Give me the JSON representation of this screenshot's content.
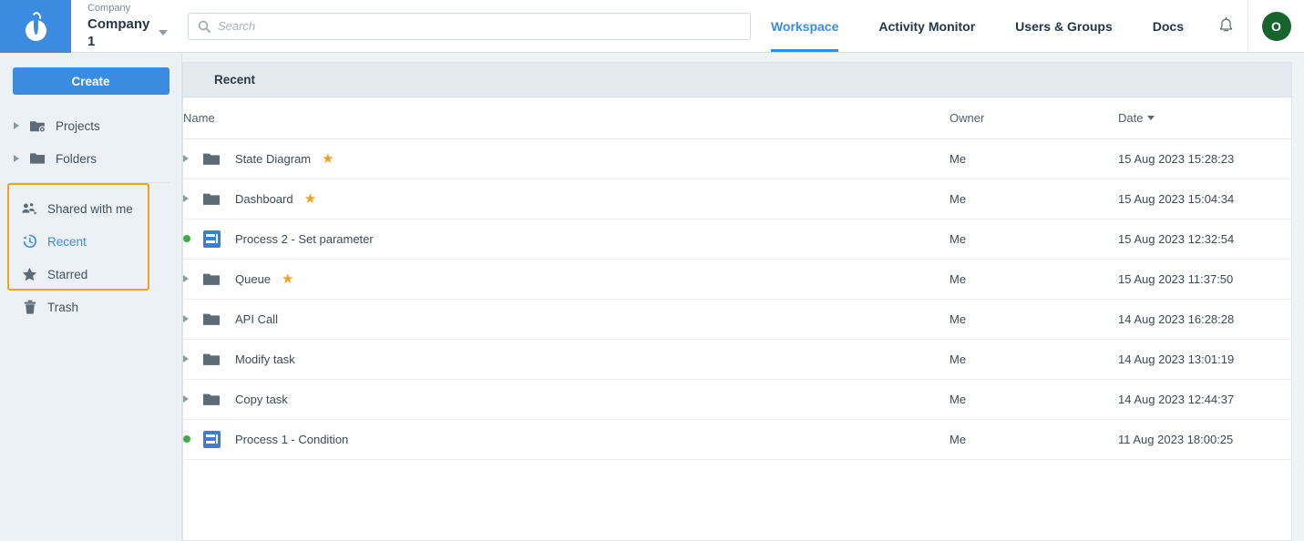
{
  "header": {
    "logo_icon": "app-logo-drop",
    "company_label": "Company",
    "company_name": "Company 1",
    "dropdown_icon": "chevron-down-icon",
    "search": {
      "value": "",
      "placeholder": "Search",
      "icon": "search-icon"
    },
    "nav": [
      {
        "label": "Workspace",
        "active": true
      },
      {
        "label": "Activity Monitor",
        "active": false
      },
      {
        "label": "Users & Groups",
        "active": false
      },
      {
        "label": "Docs",
        "active": false
      }
    ],
    "bell_icon": "notification-bell-icon",
    "avatar_initial": "O",
    "avatar_color": "#17652c",
    "accent_color": "#3b8ce0"
  },
  "sidebar": {
    "create_label": "Create",
    "tree": [
      {
        "label": "Projects",
        "icon": "folder-settings-icon"
      },
      {
        "label": "Folders",
        "icon": "folder-icon"
      }
    ],
    "highlighted_group": [
      {
        "label": "Shared with me",
        "icon": "shared-users-icon",
        "selected": false
      },
      {
        "label": "Recent",
        "icon": "history-clock-icon",
        "selected": true
      },
      {
        "label": "Starred",
        "icon": "star-icon",
        "selected": false
      },
      {
        "label": "Trash",
        "icon": "trash-icon",
        "selected": false
      }
    ],
    "highlight_color": "#f0a11e"
  },
  "main": {
    "panel_title": "Recent",
    "columns": {
      "name": "Name",
      "owner": "Owner",
      "date": "Date"
    },
    "sort_icon": "sort-descending-caret",
    "rows": [
      {
        "name": "State Diagram",
        "type": "folder",
        "starred": true,
        "owner": "Me",
        "date": "15 Aug 2023 15:28:23"
      },
      {
        "name": "Dashboard",
        "type": "folder",
        "starred": true,
        "owner": "Me",
        "date": "15 Aug 2023 15:04:34"
      },
      {
        "name": "Process 2 - Set parameter",
        "type": "process",
        "starred": false,
        "owner": "Me",
        "date": "15 Aug 2023 12:32:54"
      },
      {
        "name": "Queue",
        "type": "folder",
        "starred": true,
        "owner": "Me",
        "date": "15 Aug 2023 11:37:50"
      },
      {
        "name": "API Call",
        "type": "folder",
        "starred": false,
        "owner": "Me",
        "date": "14 Aug 2023 16:28:28"
      },
      {
        "name": "Modify task",
        "type": "folder",
        "starred": false,
        "owner": "Me",
        "date": "14 Aug 2023 13:01:19"
      },
      {
        "name": "Copy task",
        "type": "folder",
        "starred": false,
        "owner": "Me",
        "date": "14 Aug 2023 12:44:37"
      },
      {
        "name": "Process 1 - Condition",
        "type": "process",
        "starred": false,
        "owner": "Me",
        "date": "11 Aug 2023 18:00:25"
      }
    ],
    "star_glyph": "★",
    "status_dot_color": "#3cab45"
  }
}
